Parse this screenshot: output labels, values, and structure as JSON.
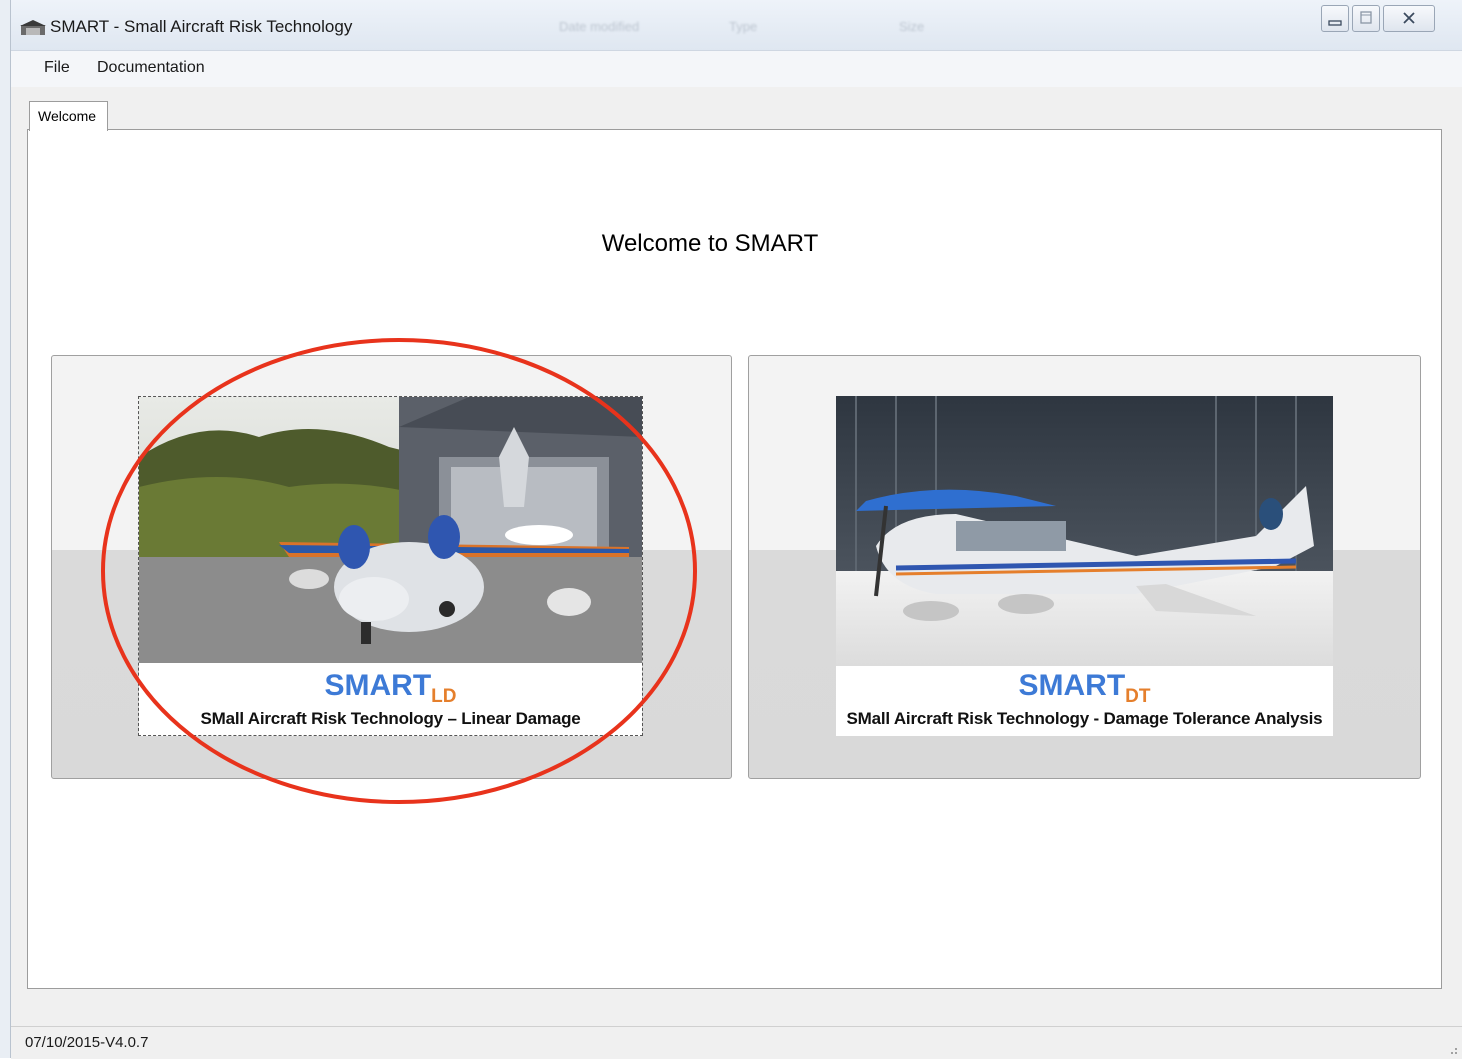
{
  "window": {
    "title": "SMART - Small Aircraft Risk Technology",
    "background_header_ghost": [
      "Date modified",
      "Type",
      "Size"
    ]
  },
  "menu": {
    "items": [
      "File",
      "Documentation"
    ]
  },
  "tabs": [
    {
      "label": "Welcome",
      "selected": true
    }
  ],
  "welcome": {
    "heading": "Welcome to SMART",
    "cards": [
      {
        "brand": "SMART",
        "subscript": "LD",
        "subtitle": "SMall Aircraft Risk Technology – Linear Damage",
        "focused": true,
        "annotated": true
      },
      {
        "brand": "SMART",
        "subscript": "DT",
        "subtitle": "SMall Aircraft Risk Technology - Damage Tolerance Analysis",
        "focused": false
      }
    ]
  },
  "status": {
    "version": "07/10/2015-V4.0.7"
  },
  "colors": {
    "brand_blue": "#3d7ad6",
    "subscript_orange": "#e57f2c",
    "annotation_red": "#e8331c"
  },
  "icons": {
    "app": "hangar-app-icon",
    "minimize": "minimize-icon",
    "maximize": "maximize-icon",
    "close": "close-icon"
  }
}
